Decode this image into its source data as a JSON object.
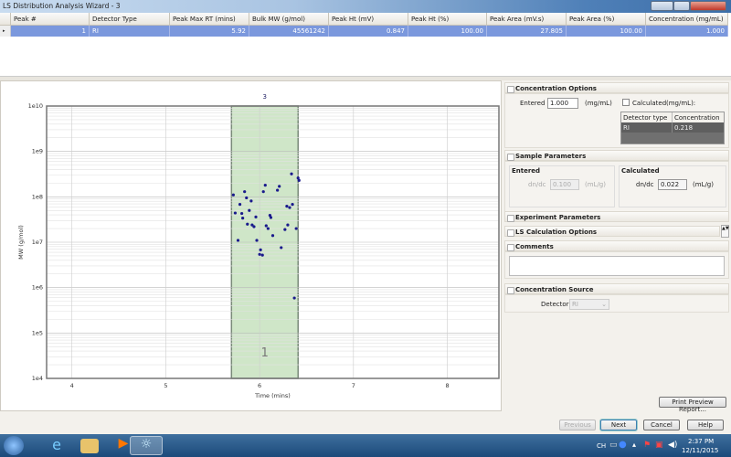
{
  "window": {
    "title": "LS Distribution Analysis Wizard - 3"
  },
  "grid": {
    "columns": [
      "Peak #",
      "Detector Type",
      "Peak Max RT (mins)",
      "Bulk MW (g/mol)",
      "Peak Ht (mV)",
      "Peak Ht (%)",
      "Peak Area (mV.s)",
      "Peak Area (%)",
      "Concentration (mg/mL)"
    ],
    "rows": [
      [
        "1",
        "RI",
        "5.92",
        "45561242",
        "0.847",
        "100.00",
        "27.805",
        "100.00",
        "1.000"
      ]
    ]
  },
  "chart_data": {
    "type": "scatter",
    "xlabel": "Time (mins)",
    "ylabel": "MW (g/mol)",
    "xlim": [
      3.73,
      8.55
    ],
    "ylim": [
      10000,
      10000000000
    ],
    "y_scale": "log",
    "grid": true,
    "x_ticks": [
      "4",
      "5",
      "6",
      "7",
      "8"
    ],
    "y_ticks": [
      "1e10",
      "1e9",
      "1e8",
      "1e7",
      "1e6",
      "1e5",
      "1e4"
    ],
    "region": {
      "x": [
        5.7,
        6.41
      ],
      "color": "#cfe6c8",
      "top_label": "3",
      "inner_label": "1"
    },
    "point_color": "#1a1a8c",
    "points": [
      [
        6.34,
        320000000.0
      ],
      [
        6.41,
        260000000.0
      ],
      [
        6.42,
        230000000.0
      ],
      [
        6.06,
        180000000.0
      ],
      [
        6.21,
        170000000.0
      ],
      [
        6.19,
        140000000.0
      ],
      [
        5.84,
        130000000.0
      ],
      [
        6.04,
        130000000.0
      ],
      [
        5.72,
        110000000.0
      ],
      [
        5.86,
        95000000.0
      ],
      [
        5.91,
        81000000.0
      ],
      [
        5.79,
        68000000.0
      ],
      [
        6.35,
        68000000.0
      ],
      [
        6.29,
        62000000.0
      ],
      [
        6.32,
        58000000.0
      ],
      [
        5.89,
        50000000.0
      ],
      [
        5.74,
        44000000.0
      ],
      [
        5.81,
        43000000.0
      ],
      [
        6.11,
        39000000.0
      ],
      [
        6.12,
        35000000.0
      ],
      [
        5.96,
        36000000.0
      ],
      [
        5.82,
        34000000.0
      ],
      [
        5.87,
        25000000.0
      ],
      [
        5.92,
        24000000.0
      ],
      [
        5.94,
        22000000.0
      ],
      [
        6.07,
        23000000.0
      ],
      [
        6.3,
        24000000.0
      ],
      [
        6.09,
        20000000.0
      ],
      [
        6.27,
        19000000.0
      ],
      [
        6.39,
        20000000.0
      ],
      [
        6.14,
        14000000.0
      ],
      [
        5.77,
        11000000.0
      ],
      [
        5.97,
        11000000.0
      ],
      [
        6.23,
        7600000.0
      ],
      [
        6.01,
        6800000.0
      ],
      [
        6.0,
        5400000.0
      ],
      [
        6.03,
        5200000.0
      ],
      [
        6.37,
        590000.0
      ]
    ]
  },
  "conc": {
    "title": "Concentration Options",
    "entered_label": "Entered",
    "entered_value": "1.000",
    "unit": "(mg/mL)",
    "calculated_label": "Calculated",
    "calc_unit": "(mg/mL):",
    "table_headers": [
      "Detector type",
      "Concentration"
    ],
    "table_row": [
      "RI",
      "0.218"
    ]
  },
  "sample": {
    "title": "Sample Parameters",
    "entered": "Entered",
    "calculated": "Calculated",
    "dndc_label": "dn/dc",
    "entered_dndc": "0.100",
    "calc_dndc": "0.022",
    "unit": "(mL/g)"
  },
  "experiment": {
    "title": "Experiment Parameters"
  },
  "lscalc": {
    "title": "LS Calculation Options"
  },
  "comments": {
    "title": "Comments",
    "value": ""
  },
  "source": {
    "title": "Concentration Source",
    "detector_label": "Detector",
    "detector_value": "RI"
  },
  "buttons": {
    "print": "Print Preview Report...",
    "previous": "Previous",
    "next": "Next",
    "cancel": "Cancel",
    "help": "Help"
  },
  "tray": {
    "lang": "CH",
    "time": "2:37 PM",
    "date": "12/11/2015"
  }
}
